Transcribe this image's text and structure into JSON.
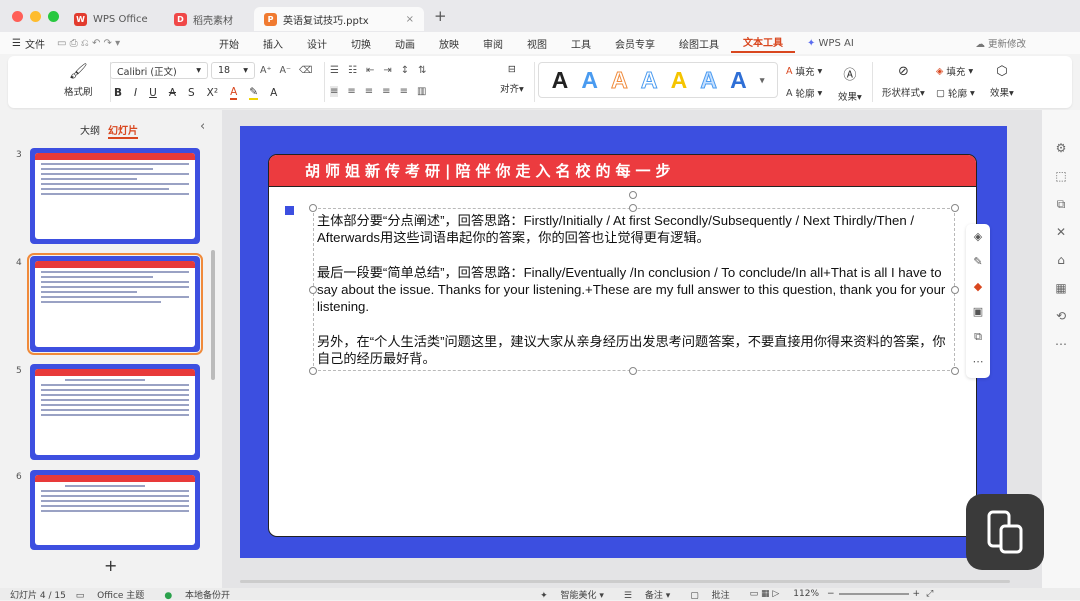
{
  "window": {
    "tabs": [
      {
        "label": "WPS Office",
        "icon": "wps-logo-icon"
      },
      {
        "label": "稻壳素材",
        "icon": "docer-icon"
      },
      {
        "label": "英语复试技巧.pptx",
        "icon": "ppt-file-icon"
      }
    ]
  },
  "menu": {
    "file": "文件",
    "items": [
      "开始",
      "插入",
      "设计",
      "切换",
      "动画",
      "放映",
      "审阅",
      "视图",
      "工具",
      "会员专享",
      "绘图工具",
      "文本工具"
    ],
    "active": "文本工具",
    "wps_ai": "WPS AI",
    "cloud": "更新修改"
  },
  "ribbon": {
    "format_painter": "格式刷",
    "font_name": "Calibri (正文)",
    "font_size": "18",
    "align_label": "对齐",
    "fill_label": "填充",
    "outline_label": "轮廓",
    "effect_label": "效果",
    "shape_style_label": "形状样式",
    "shape_fill_label": "填充",
    "shape_outline_label": "轮廓",
    "shape_effect_label": "效果"
  },
  "panel": {
    "tab_outline": "大纲",
    "tab_slides": "幻灯片",
    "active_tab": "幻灯片",
    "slides": [
      "3",
      "4",
      "5",
      "6"
    ],
    "selected_slide": "4",
    "add": "+"
  },
  "slide": {
    "header": "胡师姐新传考研|陪伴你走入名校的每一步",
    "paragraphs": [
      "主体部分要“分点阐述”，回答思路：Firstly/Initially / At first Secondly/Subsequently / Next Thirdly/Then / Afterwards用这些词语串起你的答案，你的回答也让觉得更有逻辑。",
      "最后一段要“简单总结”，回答思路：Finally/Eventually /In conclusion / To conclude/In all+That is all I have to say about the issue. Thanks for your listening.+These are my full answer to this question, thank you for your listening.",
      "另外，在“个人生活类”问题这里，建议大家从亲身经历出发思考问题答案，不要直接用你得来资料的答案，你自己的经历最好背。"
    ]
  },
  "status": {
    "slide_count": "幻灯片 4 / 15",
    "theme": "Office 主题",
    "backup": "本地备份开",
    "beautify": "智能美化",
    "notes": "备注",
    "comments": "批注",
    "zoom": "112%"
  }
}
